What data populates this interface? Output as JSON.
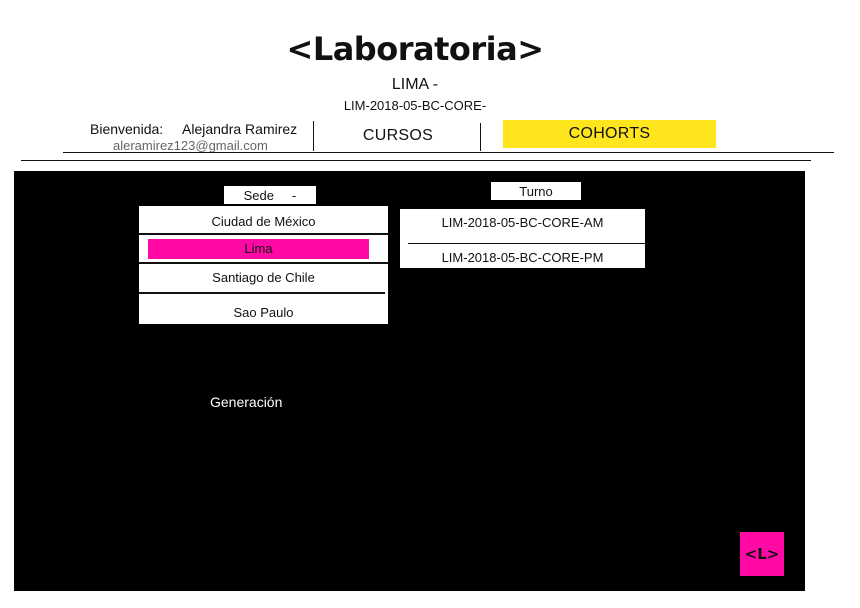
{
  "header": {
    "logo_text": "<Laboratoria>",
    "city": "LIMA -",
    "cohort_code": "LIM-2018-05-BC-CORE-"
  },
  "user": {
    "welcome_label": "Bienvenida:",
    "name": "Alejandra Ramirez",
    "email": "aleramirez123@gmail.com"
  },
  "nav": {
    "cursos": "CURSOS",
    "cohorts": "COHORTS"
  },
  "filters": {
    "sede_label": "Sede     -",
    "turno_label": "Turno",
    "generacion_label": "Generación",
    "sedes": [
      "Ciudad de México",
      "Lima",
      "Santiago de Chile",
      "Sao Paulo"
    ],
    "selected_sede": "Lima",
    "turnos": [
      "LIM-2018-05-BC-CORE-AM",
      "LIM-2018-05-BC-CORE-PM"
    ]
  },
  "badge": {
    "text": "<L>"
  },
  "colors": {
    "accent_yellow": "#ffe51e",
    "accent_pink": "#ff0aa5",
    "panel": "#000000"
  }
}
